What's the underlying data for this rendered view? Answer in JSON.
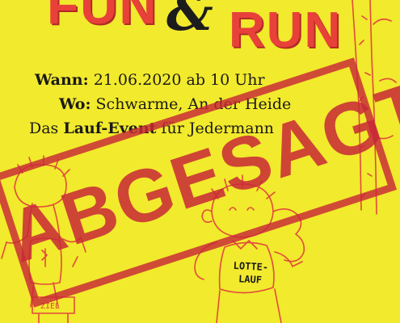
{
  "title": {
    "fun": "FUN",
    "amp": "&",
    "run": "RUN"
  },
  "details": {
    "when_label": "Wann:",
    "when_value": "21.06.2020  ab 10 Uhr",
    "where_label": "Wo:",
    "where_value": "Schwarme, An der Heide",
    "tagline_pre": "Das ",
    "tagline_bold": "Lauf-Event",
    "tagline_post": " für Jedermann"
  },
  "stamp": {
    "text": "ABGESAGT"
  },
  "shirt": {
    "line1": "LOTTE-",
    "line2": "LAUF"
  },
  "sign": {
    "text": "ZIEL"
  },
  "colors": {
    "background": "#f2ea2c",
    "title_red": "#e8413a",
    "stamp_red": "#c82837",
    "ink": "#1a1a1a",
    "line_art": "#e14b3b"
  }
}
